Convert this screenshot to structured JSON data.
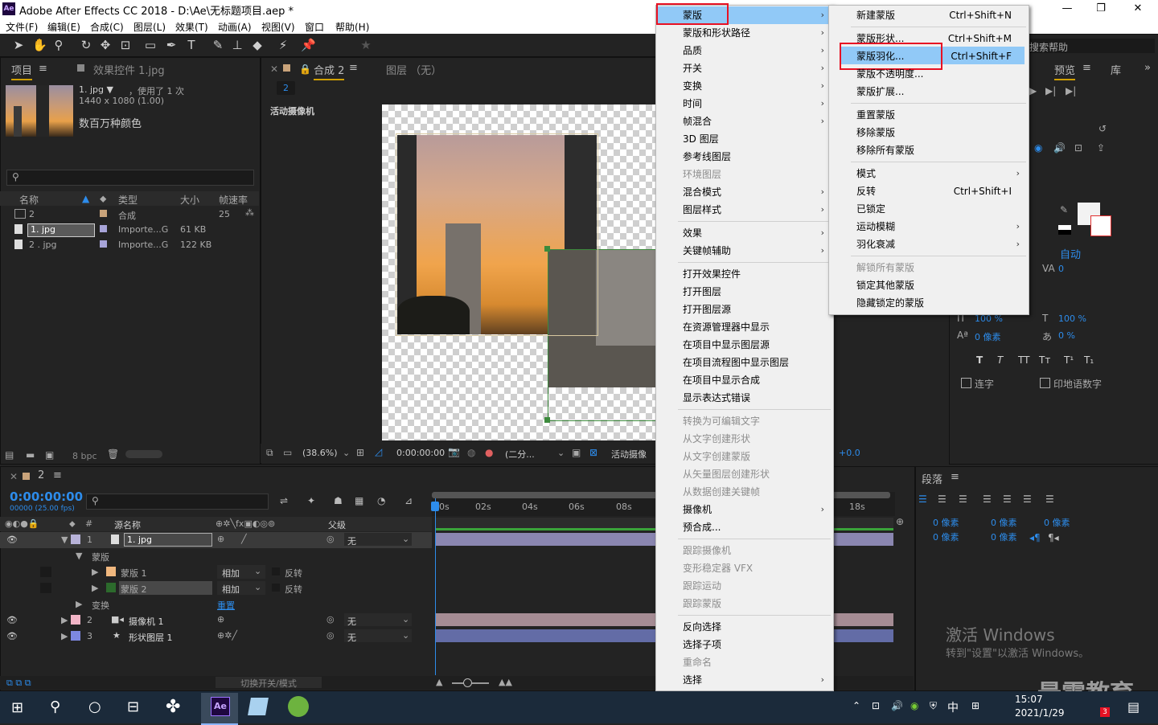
{
  "window": {
    "title": "Adobe After Effects CC 2018 - D:\\Ae\\无标题项目.aep *",
    "app_logo": "Ae",
    "minimize": "—",
    "maximize": "❐",
    "close": "✕"
  },
  "menubar": [
    "文件(F)",
    "编辑(E)",
    "合成(C)",
    "图层(L)",
    "效果(T)",
    "动画(A)",
    "视图(V)",
    "窗口",
    "帮助(H)"
  ],
  "project_panel": {
    "tab": "项目",
    "effects_tab": "效果控件 1.jpg",
    "item_name": "1. jpg ▼",
    "used": "，使用了 1 次",
    "dimensions": "1440 x 1080 (1.00)",
    "colors": "数百万种颜色",
    "search_placeholder": "",
    "columns": [
      "名称",
      "类型",
      "大小",
      "帧速率"
    ],
    "rows": [
      {
        "name": "2",
        "type": "合成",
        "size": "",
        "fps": "25"
      },
      {
        "name": "1. jpg",
        "type": "Importe...G",
        "size": "61 KB",
        "fps": ""
      },
      {
        "name": "2 . jpg",
        "type": "Importe...G",
        "size": "122 KB",
        "fps": ""
      }
    ],
    "bpc": "8 bpc"
  },
  "comp_panel": {
    "tab": "合成 2",
    "layer_tab": "图层 （无）",
    "comp_name": "2",
    "camera_label": "活动摄像机",
    "zoom": "(38.6%)",
    "timecode": "0:00:00:00",
    "resolution": "(二分...",
    "view": "活动摄像",
    "offset": "+0.0"
  },
  "context_menu": {
    "items": [
      {
        "label": "蒙版",
        "sub": true,
        "state": "active"
      },
      {
        "label": "蒙版和形状路径",
        "sub": true
      },
      {
        "label": "品质",
        "sub": true
      },
      {
        "label": "开关",
        "sub": true
      },
      {
        "label": "变换",
        "sub": true
      },
      {
        "label": "时间",
        "sub": true
      },
      {
        "label": "帧混合",
        "sub": true
      },
      {
        "label": "3D 图层",
        "sub": false
      },
      {
        "label": "参考线图层",
        "sub": false
      },
      {
        "label": "环境图层",
        "sub": false,
        "state": "disabled"
      },
      {
        "label": "混合模式",
        "sub": true
      },
      {
        "label": "图层样式",
        "sub": true
      },
      {
        "label": "效果",
        "sub": true,
        "sep_before": true
      },
      {
        "label": "关键帧辅助",
        "sub": true
      },
      {
        "label": "打开效果控件",
        "sub": false,
        "sep_before": true
      },
      {
        "label": "打开图层",
        "sub": false
      },
      {
        "label": "打开图层源",
        "sub": false
      },
      {
        "label": "在资源管理器中显示",
        "sub": false
      },
      {
        "label": "在项目中显示图层源",
        "sub": false
      },
      {
        "label": "在项目流程图中显示图层",
        "sub": false
      },
      {
        "label": "在项目中显示合成",
        "sub": false
      },
      {
        "label": "显示表达式错误",
        "sub": false
      },
      {
        "label": "转换为可编辑文字",
        "sub": false,
        "state": "disabled",
        "sep_before": true
      },
      {
        "label": "从文字创建形状",
        "sub": false,
        "state": "disabled"
      },
      {
        "label": "从文字创建蒙版",
        "sub": false,
        "state": "disabled"
      },
      {
        "label": "从矢量图层创建形状",
        "sub": false,
        "state": "disabled"
      },
      {
        "label": "从数据创建关键帧",
        "sub": false,
        "state": "disabled"
      },
      {
        "label": "摄像机",
        "sub": true
      },
      {
        "label": "预合成...",
        "sub": false
      },
      {
        "label": "跟踪摄像机",
        "sub": false,
        "state": "disabled",
        "sep_before": true
      },
      {
        "label": "变形稳定器 VFX",
        "sub": false,
        "state": "disabled"
      },
      {
        "label": "跟踪运动",
        "sub": false,
        "state": "disabled"
      },
      {
        "label": "跟踪蒙版",
        "sub": false,
        "state": "disabled"
      },
      {
        "label": "反向选择",
        "sub": false,
        "sep_before": true
      },
      {
        "label": "选择子项",
        "sub": false
      },
      {
        "label": "重命名",
        "sub": false,
        "state": "disabled"
      },
      {
        "label": "选择",
        "sub": true
      }
    ]
  },
  "submenu": {
    "items": [
      {
        "label": "新建蒙版",
        "shortcut": "Ctrl+Shift+N"
      },
      {
        "label": "蒙版形状...",
        "shortcut": "Ctrl+Shift+M",
        "sep_before": true
      },
      {
        "label": "蒙版羽化...",
        "shortcut": "Ctrl+Shift+F",
        "state": "active"
      },
      {
        "label": "蒙版不透明度...",
        "shortcut": ""
      },
      {
        "label": "蒙版扩展...",
        "shortcut": ""
      },
      {
        "label": "重置蒙版",
        "shortcut": "",
        "sep_before": true
      },
      {
        "label": "移除蒙版",
        "shortcut": ""
      },
      {
        "label": "移除所有蒙版",
        "shortcut": ""
      },
      {
        "label": "模式",
        "shortcut": "",
        "sub": true,
        "sep_before": true
      },
      {
        "label": "反转",
        "shortcut": "Ctrl+Shift+I"
      },
      {
        "label": "已锁定",
        "shortcut": ""
      },
      {
        "label": "运动模糊",
        "shortcut": "",
        "sub": true
      },
      {
        "label": "羽化衰减",
        "shortcut": "",
        "sub": true
      },
      {
        "label": "解锁所有蒙版",
        "shortcut": "",
        "state": "disabled",
        "sep_before": true
      },
      {
        "label": "锁定其他蒙版",
        "shortcut": ""
      },
      {
        "label": "隐藏锁定的蒙版",
        "shortcut": ""
      }
    ]
  },
  "right_panel": {
    "search_help": "搜索帮助",
    "preview_tab": "预览",
    "library_tab": "库",
    "auto": "自动",
    "va_value": "0",
    "scale_v": "100 %",
    "scale_h": "100 %",
    "baseline": "0 像素",
    "tsume": "0 %",
    "ligature": "连字",
    "hindi_digits": "印地语数字",
    "paragraph_tab": "段落",
    "indent_values": [
      "0 像素",
      "0 像素",
      "0 像素",
      "0 像素",
      "0 像素"
    ]
  },
  "timeline": {
    "comp_tab": "2",
    "timecode": "0:00:00:00",
    "timecode_sub": "00000 (25.00 fps)",
    "col_source": "源名称",
    "col_parent": "父级",
    "ruler": [
      "0s",
      "02s",
      "04s",
      "06s",
      "08s",
      "18s"
    ],
    "layers": [
      {
        "num": "1",
        "name": "1. jpg",
        "parent": "无",
        "color": "#b7b2d8"
      },
      {
        "num": "",
        "name": "蒙版",
        "parent": "",
        "color": ""
      },
      {
        "num": "",
        "name": "蒙版 1",
        "mode": "相加",
        "invert": "反转",
        "color": "#f0b77e"
      },
      {
        "num": "",
        "name": "蒙版 2",
        "mode": "相加",
        "invert": "反转",
        "color": "#2c6a2c"
      },
      {
        "num": "",
        "name": "变换",
        "reset": "重置",
        "color": ""
      },
      {
        "num": "2",
        "name": "摄像机 1",
        "parent": "无",
        "color": "#f2b5c7"
      },
      {
        "num": "3",
        "name": "形状图层 1",
        "parent": "无",
        "color": "#7d88e0"
      }
    ],
    "toggle_label": "切换开关/模式"
  },
  "watermark": {
    "line1": "激活 Windows",
    "line2": "转到\"设置\"以激活 Windows。",
    "brand": "最需教育"
  },
  "taskbar": {
    "time": "15:07",
    "date": "2021/1/29",
    "ime": "中",
    "badge": "3"
  }
}
